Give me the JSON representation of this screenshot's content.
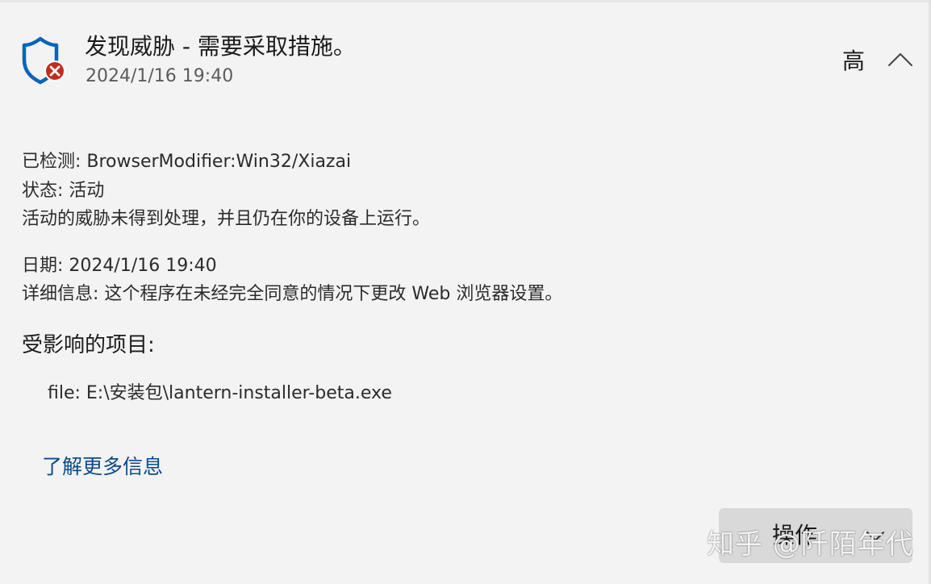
{
  "header": {
    "title": "发现威胁 - 需要采取措施。",
    "timestamp": "2024/1/16 19:40",
    "severity": "高",
    "icon": "shield-error-icon"
  },
  "details": {
    "detected": "已检测: BrowserModifier:Win32/Xiazai",
    "status": "状态: 活动",
    "status_description": "活动的威胁未得到处理，并且仍在你的设备上运行。",
    "date": "日期:  2024/1/16 19:40",
    "info": "详细信息: 这个程序在未经完全同意的情况下更改 Web 浏览器设置。"
  },
  "affected": {
    "heading": "受影响的项目:",
    "items": [
      "file: E:\\安装包\\lantern-installer-beta.exe"
    ]
  },
  "links": {
    "learn_more": "了解更多信息"
  },
  "actions": {
    "button_label": "操作",
    "chevron_icon": "chevron-down-icon"
  },
  "watermark": {
    "text": "知乎 @阡陌年代"
  },
  "colors": {
    "shield": "#0a64b8",
    "error_badge": "#c42b1c",
    "link": "#0b4a8c",
    "background": "#f3f3f3",
    "button_bg": "#d9d9d9"
  }
}
